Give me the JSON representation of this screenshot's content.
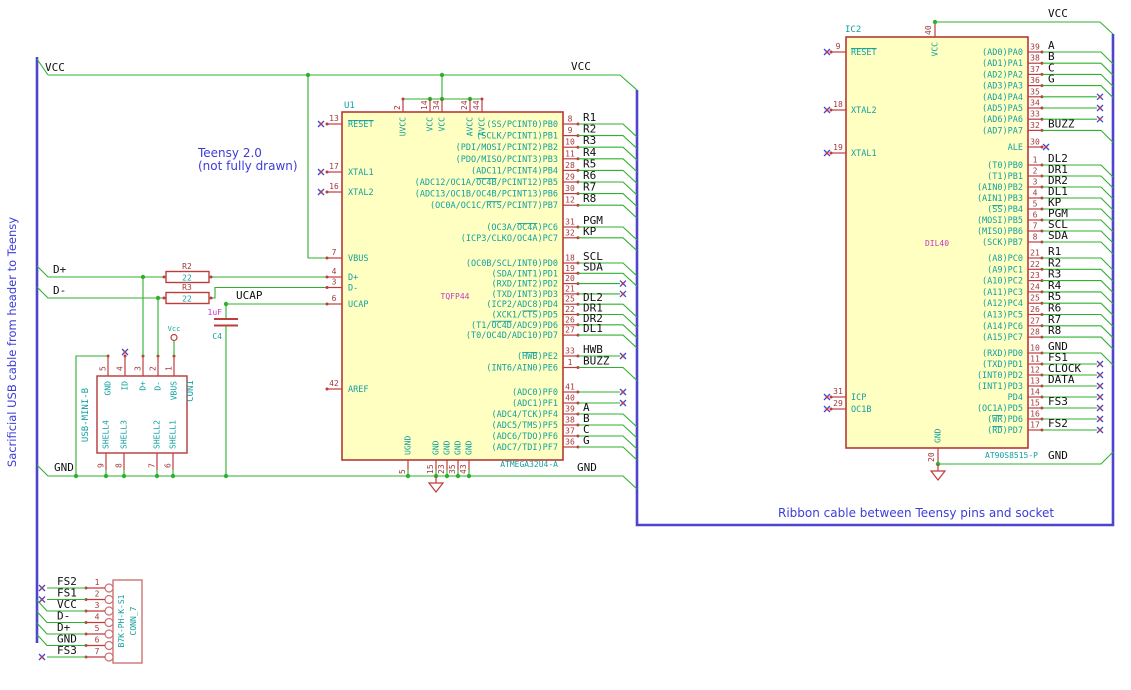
{
  "colors": {
    "wire": "#2fb12f",
    "bus": "#4d45cc",
    "pin": "#c03c3c",
    "body_fill": "#ffffc2",
    "body_border": "#b73737",
    "conn_border": "#cc7373",
    "pin_name": "#13a0a0",
    "pin_num": "#a33838",
    "value": "#c239c2",
    "note": "#3d3dd8",
    "nc": "#4747d2",
    "label": "#101010"
  },
  "notes": {
    "teensy_title": "Teensy 2.0",
    "teensy_sub": "(not fully drawn)",
    "left_cable": "Sacrificial USB cable from header to Teensy",
    "ribbon": "Ribbon cable between Teensy pins and socket"
  },
  "net_labels": {
    "vcc": "VCC",
    "gnd": "GND",
    "dplus": "D+",
    "dminus": "D-",
    "ucap": "UCAP"
  },
  "u1": {
    "ref": "U1",
    "package": "TQFP44",
    "part": "ATMEGA32U4-A",
    "left_pins": [
      {
        "num": "13",
        "name": "~RESET~",
        "nc": true
      },
      {
        "num": "17",
        "name": "XTAL1",
        "nc": true
      },
      {
        "num": "16",
        "name": "XTAL2",
        "nc": true
      },
      {
        "num": "7",
        "name": "VBUS"
      },
      {
        "num": "4",
        "name": "D+"
      },
      {
        "num": "3",
        "name": "D-"
      },
      {
        "num": "6",
        "name": "UCAP"
      },
      {
        "num": "42",
        "name": "AREF",
        "open": true
      }
    ],
    "top_pins": [
      {
        "num": "2",
        "name": "UVCC"
      },
      {
        "num": "14",
        "name": "VCC"
      },
      {
        "num": "34",
        "name": "VCC"
      },
      {
        "num": "24",
        "name": "AVCC"
      },
      {
        "num": "44",
        "name": "AVCC"
      }
    ],
    "bottom_pins": [
      {
        "num": "5",
        "name": "UGND"
      },
      {
        "num": "15",
        "name": "GND"
      },
      {
        "num": "23",
        "name": "GND"
      },
      {
        "num": "35",
        "name": "GND"
      },
      {
        "num": "43",
        "name": "GND"
      }
    ],
    "right_pins": [
      {
        "name": "(SS/PCINT0)PB0",
        "num": "8",
        "net": "R1",
        "bus": true
      },
      {
        "name": "(SCLK/PCINT1)PB1",
        "num": "9",
        "net": "R2",
        "bus": true
      },
      {
        "name": "(PDI/MOSI/PCINT2)PB2",
        "num": "10",
        "net": "R3",
        "bus": true
      },
      {
        "name": "(PDO/MISO/PCINT3)PB3",
        "num": "11",
        "net": "R4",
        "bus": true
      },
      {
        "name": "(ADC11/PCINT4)PB4",
        "num": "28",
        "net": "R5",
        "bus": true
      },
      {
        "name": "(ADC12/OC1A/~OC4B~/PCINT12)PB5",
        "num": "29",
        "net": "R6",
        "bus": true
      },
      {
        "name": "(ADC13/OC1B/OC4B/PCINT13)PB6",
        "num": "30",
        "net": "R7",
        "bus": true
      },
      {
        "name": "(OC0A/OC1C/~RTS~/PCINT7)PB7",
        "num": "12",
        "net": "R8",
        "bus": true
      },
      {
        "name": "(OC3A/~OC4A~)PC6",
        "num": "31",
        "net": "PGM",
        "bus": true
      },
      {
        "name": "(ICP3/CLKO/OC4A)PC7",
        "num": "32",
        "net": "KP",
        "bus": true
      },
      {
        "name": "(OC0B/SCL/INT0)PD0",
        "num": "18",
        "net": "SCL",
        "bus": true
      },
      {
        "name": "(SDA/INT1)PD1",
        "num": "19",
        "net": "SDA",
        "bus": true
      },
      {
        "name": "(RXD/INT2)PD2",
        "num": "20",
        "nc": true
      },
      {
        "name": "(TXD/INT3)PD3",
        "num": "21",
        "nc": true
      },
      {
        "name": "(ICP2/ADC8)PD4",
        "num": "25",
        "net": "DL2",
        "bus": true
      },
      {
        "name": "(XCK1/~CTS~)PD5",
        "num": "22",
        "net": "DR1",
        "bus": true
      },
      {
        "name": "(T1/~OC4D~/ADC9)PD6",
        "num": "26",
        "net": "DR2",
        "bus": true
      },
      {
        "name": "(T0/OC4D/ADC10)PD7",
        "num": "27",
        "net": "DL1",
        "bus": true
      },
      {
        "name": "(~HWB~)PE2",
        "num": "33",
        "net": "HWB",
        "nc": true
      },
      {
        "name": "(INT6/AIN0)PE6",
        "num": "1",
        "net": "BUZZ",
        "bus": true
      },
      {
        "name": "(ADC0)PF0",
        "num": "41",
        "nc": true
      },
      {
        "name": "(ADC1)PF1",
        "num": "40",
        "nc": true
      },
      {
        "name": "(ADC4/TCK)PF4",
        "num": "39",
        "net": "A",
        "bus": true
      },
      {
        "name": "(ADC5/TMS)PF5",
        "num": "38",
        "net": "B",
        "bus": true
      },
      {
        "name": "(ADC6/TDO)PF6",
        "num": "37",
        "net": "C",
        "bus": true
      },
      {
        "name": "(ADC7/TDI)PF7",
        "num": "36",
        "net": "G",
        "bus": true
      }
    ]
  },
  "ic2": {
    "ref": "IC2",
    "package": "DIL40",
    "part": "AT90S8515-P",
    "top_pin": {
      "num": "40",
      "name": "VCC"
    },
    "bottom_pin": {
      "num": "20",
      "name": "GND"
    },
    "left_pins": [
      {
        "num": "9",
        "name": "~RESET~",
        "nc": true
      },
      {
        "num": "18",
        "name": "XTAL2",
        "nc": true
      },
      {
        "num": "19",
        "name": "XTAL1",
        "nc": true
      },
      {
        "num": "31",
        "name": "ICP",
        "nc": true
      },
      {
        "num": "29",
        "name": "OC1B",
        "nc": true
      }
    ],
    "right_pins": [
      {
        "name": "(AD0)PA0",
        "num": "39",
        "net": "A",
        "bus": true
      },
      {
        "name": "(AD1)PA1",
        "num": "38",
        "net": "B",
        "bus": true
      },
      {
        "name": "(AD2)PA2",
        "num": "37",
        "net": "C",
        "bus": true
      },
      {
        "name": "(AD3)PA3",
        "num": "36",
        "net": "G",
        "bus": true
      },
      {
        "name": "(AD4)PA4",
        "num": "35",
        "nc": true
      },
      {
        "name": "(AD5)PA5",
        "num": "34",
        "nc": true
      },
      {
        "name": "(AD6)PA6",
        "num": "33",
        "nc": true
      },
      {
        "name": "(AD7)PA7",
        "num": "32",
        "net": "BUZZ",
        "bus": true
      },
      {
        "name": "ALE",
        "num": "30",
        "nc": true,
        "short": true
      },
      {
        "name": "(T0)PB0",
        "num": "1",
        "net": "DL2",
        "bus": true
      },
      {
        "name": "(T1)PB1",
        "num": "2",
        "net": "DR1",
        "bus": true
      },
      {
        "name": "(AIN0)PB2",
        "num": "3",
        "net": "DR2",
        "bus": true
      },
      {
        "name": "(AIN1)PB3",
        "num": "4",
        "net": "DL1",
        "bus": true
      },
      {
        "name": "(~SS~)PB4",
        "num": "5",
        "net": "KP",
        "bus": true
      },
      {
        "name": "(MOSI)PB5",
        "num": "6",
        "net": "PGM",
        "bus": true
      },
      {
        "name": "(MISO)PB6",
        "num": "7",
        "net": "SCL",
        "bus": true
      },
      {
        "name": "(SCK)PB7",
        "num": "8",
        "net": "SDA",
        "bus": true
      },
      {
        "name": "(A8)PC0",
        "num": "21",
        "net": "R1",
        "bus": true
      },
      {
        "name": "(A9)PC1",
        "num": "22",
        "net": "R2",
        "bus": true
      },
      {
        "name": "(A10)PC2",
        "num": "23",
        "net": "R3",
        "bus": true
      },
      {
        "name": "(A11)PC3",
        "num": "24",
        "net": "R4",
        "bus": true
      },
      {
        "name": "(A12)PC4",
        "num": "25",
        "net": "R5",
        "bus": true
      },
      {
        "name": "(A13)PC5",
        "num": "26",
        "net": "R6",
        "bus": true
      },
      {
        "name": "(A14)PC6",
        "num": "27",
        "net": "R7",
        "bus": true
      },
      {
        "name": "(A15)PC7",
        "num": "28",
        "net": "R8",
        "bus": true
      },
      {
        "name": "(RXD)PD0",
        "num": "10",
        "net": "GND",
        "bus": true
      },
      {
        "name": "(TXD)PD1",
        "num": "11",
        "net": "FS1",
        "nc": true
      },
      {
        "name": "(INT0)PD2",
        "num": "12",
        "net": "CLOCK",
        "nc": true
      },
      {
        "name": "(INT1)PD3",
        "num": "13",
        "net": "DATA",
        "nc": true
      },
      {
        "name": "PD4",
        "num": "14",
        "nc": true
      },
      {
        "name": "(OC1A)PD5",
        "num": "15",
        "net": "FS3",
        "nc": true
      },
      {
        "name": "(~WR~)PD6",
        "num": "16",
        "nc": true
      },
      {
        "name": "(~RD~)PD7",
        "num": "17",
        "net": "FS2",
        "nc": true
      }
    ]
  },
  "con1": {
    "ref": "CON1",
    "value": "USB-MINI-B",
    "top_pins": [
      {
        "num": "5",
        "name": "GND"
      },
      {
        "num": "4",
        "name": "ID",
        "nc": true
      },
      {
        "num": "3",
        "name": "D+"
      },
      {
        "num": "2",
        "name": "D-"
      },
      {
        "num": "1",
        "name": "VBUS"
      }
    ],
    "bottom_pins": [
      {
        "num": "9",
        "name": "SHELL4"
      },
      {
        "num": "8",
        "name": "SHELL3"
      },
      {
        "num": "7",
        "name": "SHELL2"
      },
      {
        "num": "6",
        "name": "SHELL1"
      }
    ]
  },
  "conn7": {
    "ref": "CONN_7",
    "value": "B7K-PH-K-S1",
    "pins": [
      {
        "num": "1",
        "net": "FS2",
        "nc": true
      },
      {
        "num": "2",
        "net": "FS1",
        "nc": true
      },
      {
        "num": "3",
        "net": "VCC"
      },
      {
        "num": "4",
        "net": "D-"
      },
      {
        "num": "5",
        "net": "D+"
      },
      {
        "num": "6",
        "net": "GND"
      },
      {
        "num": "7",
        "net": "FS3",
        "nc": true
      }
    ]
  },
  "r2": {
    "ref": "R2",
    "value": "22"
  },
  "r3": {
    "ref": "R3",
    "value": "22"
  },
  "c4": {
    "ref": "C4",
    "value": "1uF"
  },
  "power_flag": {
    "label": "Vcc"
  }
}
